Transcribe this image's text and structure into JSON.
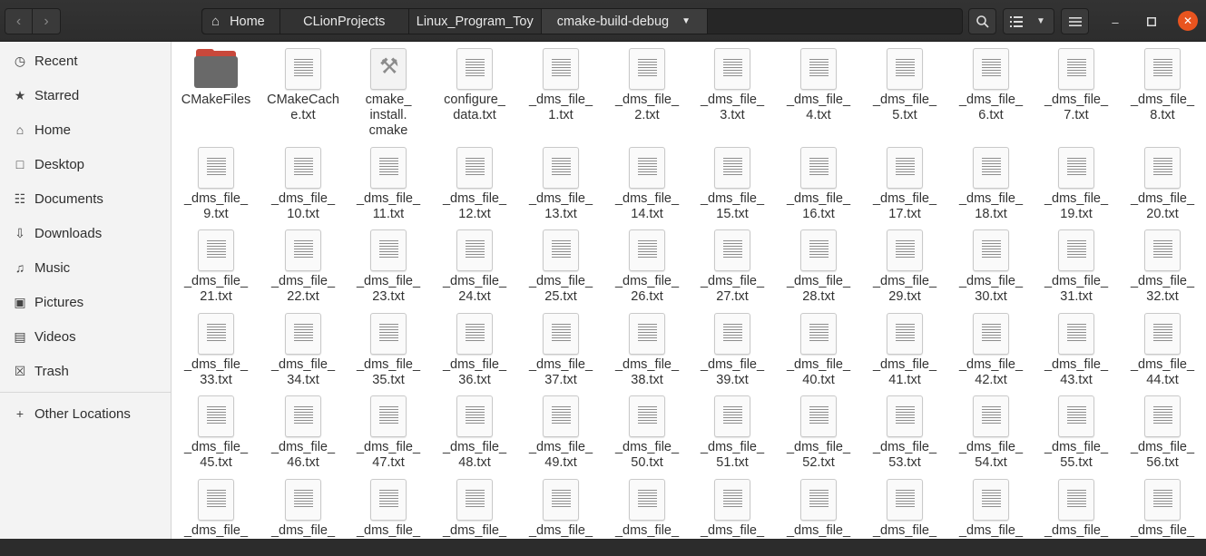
{
  "header": {
    "nav": {
      "back_icon": "chevron-left-icon",
      "forward_icon": "chevron-right-icon"
    },
    "breadcrumbs": [
      "Home",
      "CLionProjects",
      "Linux_Program_Toy",
      "cmake-build-debug"
    ],
    "buttons": {
      "search_icon": "search-icon",
      "view_list_icon": "list-view-icon",
      "view_options_icon": "chevron-down-icon",
      "menu_icon": "hamburger-menu-icon"
    },
    "window": {
      "minimize_icon": "minimize-icon",
      "maximize_icon": "maximize-icon",
      "close_icon": "close-icon",
      "close_color": "#e9541f"
    }
  },
  "sidebar": {
    "items": [
      {
        "label": "Recent",
        "icon": "clock-icon"
      },
      {
        "label": "Starred",
        "icon": "star-icon"
      },
      {
        "label": "Home",
        "icon": "home-icon"
      },
      {
        "label": "Desktop",
        "icon": "desktop-icon"
      },
      {
        "label": "Documents",
        "icon": "document-icon"
      },
      {
        "label": "Downloads",
        "icon": "download-icon"
      },
      {
        "label": "Music",
        "icon": "music-icon"
      },
      {
        "label": "Pictures",
        "icon": "picture-icon"
      },
      {
        "label": "Videos",
        "icon": "video-icon"
      },
      {
        "label": "Trash",
        "icon": "trash-icon"
      }
    ],
    "other_locations": {
      "label": "Other Locations",
      "icon": "plus-icon"
    }
  },
  "files": [
    {
      "name": "CMakeFiles",
      "label_lines": [
        "CMakeFiles"
      ],
      "kind": "folder"
    },
    {
      "name": "CMakeCache.txt",
      "label_lines": [
        "CMakeCach",
        "e.txt"
      ],
      "kind": "text"
    },
    {
      "name": "cmake_install.cmake",
      "label_lines": [
        "cmake_",
        "install.",
        "cmake"
      ],
      "kind": "script"
    },
    {
      "name": "configure_data.txt",
      "label_lines": [
        "configure_",
        "data.txt"
      ],
      "kind": "text"
    },
    {
      "name": "_dms_file_1.txt",
      "label_lines": [
        "_dms_file_",
        "1.txt"
      ],
      "kind": "text"
    },
    {
      "name": "_dms_file_2.txt",
      "label_lines": [
        "_dms_file_",
        "2.txt"
      ],
      "kind": "text"
    },
    {
      "name": "_dms_file_3.txt",
      "label_lines": [
        "_dms_file_",
        "3.txt"
      ],
      "kind": "text"
    },
    {
      "name": "_dms_file_4.txt",
      "label_lines": [
        "_dms_file_",
        "4.txt"
      ],
      "kind": "text"
    },
    {
      "name": "_dms_file_5.txt",
      "label_lines": [
        "_dms_file_",
        "5.txt"
      ],
      "kind": "text"
    },
    {
      "name": "_dms_file_6.txt",
      "label_lines": [
        "_dms_file_",
        "6.txt"
      ],
      "kind": "text"
    },
    {
      "name": "_dms_file_7.txt",
      "label_lines": [
        "_dms_file_",
        "7.txt"
      ],
      "kind": "text"
    },
    {
      "name": "_dms_file_8.txt",
      "label_lines": [
        "_dms_file_",
        "8.txt"
      ],
      "kind": "text"
    },
    {
      "name": "_dms_file_9.txt",
      "label_lines": [
        "_dms_file_",
        "9.txt"
      ],
      "kind": "text"
    },
    {
      "name": "_dms_file_10.txt",
      "label_lines": [
        "_dms_file_",
        "10.txt"
      ],
      "kind": "text"
    },
    {
      "name": "_dms_file_11.txt",
      "label_lines": [
        "_dms_file_",
        "11.txt"
      ],
      "kind": "text"
    },
    {
      "name": "_dms_file_12.txt",
      "label_lines": [
        "_dms_file_",
        "12.txt"
      ],
      "kind": "text"
    },
    {
      "name": "_dms_file_13.txt",
      "label_lines": [
        "_dms_file_",
        "13.txt"
      ],
      "kind": "text"
    },
    {
      "name": "_dms_file_14.txt",
      "label_lines": [
        "_dms_file_",
        "14.txt"
      ],
      "kind": "text"
    },
    {
      "name": "_dms_file_15.txt",
      "label_lines": [
        "_dms_file_",
        "15.txt"
      ],
      "kind": "text"
    },
    {
      "name": "_dms_file_16.txt",
      "label_lines": [
        "_dms_file_",
        "16.txt"
      ],
      "kind": "text"
    },
    {
      "name": "_dms_file_17.txt",
      "label_lines": [
        "_dms_file_",
        "17.txt"
      ],
      "kind": "text"
    },
    {
      "name": "_dms_file_18.txt",
      "label_lines": [
        "_dms_file_",
        "18.txt"
      ],
      "kind": "text"
    },
    {
      "name": "_dms_file_19.txt",
      "label_lines": [
        "_dms_file_",
        "19.txt"
      ],
      "kind": "text"
    },
    {
      "name": "_dms_file_20.txt",
      "label_lines": [
        "_dms_file_",
        "20.txt"
      ],
      "kind": "text"
    },
    {
      "name": "_dms_file_21.txt",
      "label_lines": [
        "_dms_file_",
        "21.txt"
      ],
      "kind": "text"
    },
    {
      "name": "_dms_file_22.txt",
      "label_lines": [
        "_dms_file_",
        "22.txt"
      ],
      "kind": "text"
    },
    {
      "name": "_dms_file_23.txt",
      "label_lines": [
        "_dms_file_",
        "23.txt"
      ],
      "kind": "text"
    },
    {
      "name": "_dms_file_24.txt",
      "label_lines": [
        "_dms_file_",
        "24.txt"
      ],
      "kind": "text"
    },
    {
      "name": "_dms_file_25.txt",
      "label_lines": [
        "_dms_file_",
        "25.txt"
      ],
      "kind": "text"
    },
    {
      "name": "_dms_file_26.txt",
      "label_lines": [
        "_dms_file_",
        "26.txt"
      ],
      "kind": "text"
    },
    {
      "name": "_dms_file_27.txt",
      "label_lines": [
        "_dms_file_",
        "27.txt"
      ],
      "kind": "text"
    },
    {
      "name": "_dms_file_28.txt",
      "label_lines": [
        "_dms_file_",
        "28.txt"
      ],
      "kind": "text"
    },
    {
      "name": "_dms_file_29.txt",
      "label_lines": [
        "_dms_file_",
        "29.txt"
      ],
      "kind": "text"
    },
    {
      "name": "_dms_file_30.txt",
      "label_lines": [
        "_dms_file_",
        "30.txt"
      ],
      "kind": "text"
    },
    {
      "name": "_dms_file_31.txt",
      "label_lines": [
        "_dms_file_",
        "31.txt"
      ],
      "kind": "text"
    },
    {
      "name": "_dms_file_32.txt",
      "label_lines": [
        "_dms_file_",
        "32.txt"
      ],
      "kind": "text"
    },
    {
      "name": "_dms_file_33.txt",
      "label_lines": [
        "_dms_file_",
        "33.txt"
      ],
      "kind": "text"
    },
    {
      "name": "_dms_file_34.txt",
      "label_lines": [
        "_dms_file_",
        "34.txt"
      ],
      "kind": "text"
    },
    {
      "name": "_dms_file_35.txt",
      "label_lines": [
        "_dms_file_",
        "35.txt"
      ],
      "kind": "text"
    },
    {
      "name": "_dms_file_36.txt",
      "label_lines": [
        "_dms_file_",
        "36.txt"
      ],
      "kind": "text"
    },
    {
      "name": "_dms_file_37.txt",
      "label_lines": [
        "_dms_file_",
        "37.txt"
      ],
      "kind": "text"
    },
    {
      "name": "_dms_file_38.txt",
      "label_lines": [
        "_dms_file_",
        "38.txt"
      ],
      "kind": "text"
    },
    {
      "name": "_dms_file_39.txt",
      "label_lines": [
        "_dms_file_",
        "39.txt"
      ],
      "kind": "text"
    },
    {
      "name": "_dms_file_40.txt",
      "label_lines": [
        "_dms_file_",
        "40.txt"
      ],
      "kind": "text"
    },
    {
      "name": "_dms_file_41.txt",
      "label_lines": [
        "_dms_file_",
        "41.txt"
      ],
      "kind": "text"
    },
    {
      "name": "_dms_file_42.txt",
      "label_lines": [
        "_dms_file_",
        "42.txt"
      ],
      "kind": "text"
    },
    {
      "name": "_dms_file_43.txt",
      "label_lines": [
        "_dms_file_",
        "43.txt"
      ],
      "kind": "text"
    },
    {
      "name": "_dms_file_44.txt",
      "label_lines": [
        "_dms_file_",
        "44.txt"
      ],
      "kind": "text"
    },
    {
      "name": "_dms_file_45.txt",
      "label_lines": [
        "_dms_file_",
        "45.txt"
      ],
      "kind": "text"
    },
    {
      "name": "_dms_file_46.txt",
      "label_lines": [
        "_dms_file_",
        "46.txt"
      ],
      "kind": "text"
    },
    {
      "name": "_dms_file_47.txt",
      "label_lines": [
        "_dms_file_",
        "47.txt"
      ],
      "kind": "text"
    },
    {
      "name": "_dms_file_48.txt",
      "label_lines": [
        "_dms_file_",
        "48.txt"
      ],
      "kind": "text"
    },
    {
      "name": "_dms_file_49.txt",
      "label_lines": [
        "_dms_file_",
        "49.txt"
      ],
      "kind": "text"
    },
    {
      "name": "_dms_file_50.txt",
      "label_lines": [
        "_dms_file_",
        "50.txt"
      ],
      "kind": "text"
    },
    {
      "name": "_dms_file_51.txt",
      "label_lines": [
        "_dms_file_",
        "51.txt"
      ],
      "kind": "text"
    },
    {
      "name": "_dms_file_52.txt",
      "label_lines": [
        "_dms_file_",
        "52.txt"
      ],
      "kind": "text"
    },
    {
      "name": "_dms_file_53.txt",
      "label_lines": [
        "_dms_file_",
        "53.txt"
      ],
      "kind": "text"
    },
    {
      "name": "_dms_file_54.txt",
      "label_lines": [
        "_dms_file_",
        "54.txt"
      ],
      "kind": "text"
    },
    {
      "name": "_dms_file_55.txt",
      "label_lines": [
        "_dms_file_",
        "55.txt"
      ],
      "kind": "text"
    },
    {
      "name": "_dms_file_56.txt",
      "label_lines": [
        "_dms_file_",
        "56.txt"
      ],
      "kind": "text"
    },
    {
      "name": "_dms_file_",
      "label_lines": [
        "_dms_file_"
      ],
      "kind": "text"
    },
    {
      "name": "_dms_file_",
      "label_lines": [
        "_dms_file_"
      ],
      "kind": "text"
    },
    {
      "name": "_dms_file_",
      "label_lines": [
        "_dms_file_"
      ],
      "kind": "text"
    },
    {
      "name": "_dms_file_",
      "label_lines": [
        "_dms_file_"
      ],
      "kind": "text"
    },
    {
      "name": "_dms_file_",
      "label_lines": [
        "_dms_file_"
      ],
      "kind": "text"
    },
    {
      "name": "_dms_file_",
      "label_lines": [
        "_dms_file_"
      ],
      "kind": "text"
    },
    {
      "name": "_dms_file_",
      "label_lines": [
        "_dms_file_"
      ],
      "kind": "text"
    },
    {
      "name": "_dms_file_",
      "label_lines": [
        "_dms_file_"
      ],
      "kind": "text"
    },
    {
      "name": "_dms_file_",
      "label_lines": [
        "_dms_file_"
      ],
      "kind": "text"
    },
    {
      "name": "_dms_file_",
      "label_lines": [
        "_dms_file_"
      ],
      "kind": "text"
    },
    {
      "name": "_dms_file_",
      "label_lines": [
        "_dms_file_"
      ],
      "kind": "text"
    },
    {
      "name": "_dms_file_",
      "label_lines": [
        "_dms_file_"
      ],
      "kind": "text"
    }
  ],
  "colors": {
    "accent_close": "#e9541f",
    "folder_tab": "#c9483b",
    "folder_body": "#696969"
  }
}
